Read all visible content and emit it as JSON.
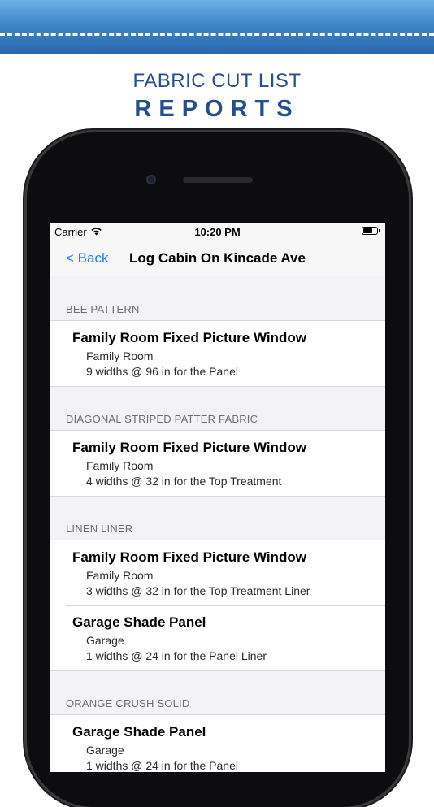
{
  "promo": {
    "line1": "FABRIC CUT LIST",
    "line2": "REPORTS"
  },
  "status_bar": {
    "carrier": "Carrier",
    "time": "10:20 PM"
  },
  "nav": {
    "back_label": "< Back",
    "title": "Log Cabin On Kincade Ave"
  },
  "sections": [
    {
      "header": "BEE PATTERN",
      "rows": [
        {
          "title": "Family Room Fixed Picture Window",
          "room": "Family Room",
          "detail": "9 widths @ 96 in for the Panel"
        }
      ]
    },
    {
      "header": "DIAGONAL STRIPED PATTER FABRIC",
      "rows": [
        {
          "title": "Family Room Fixed Picture Window",
          "room": "Family Room",
          "detail": "4 widths @ 32 in for the Top Treatment"
        }
      ]
    },
    {
      "header": "LINEN LINER",
      "rows": [
        {
          "title": "Family Room Fixed Picture Window",
          "room": "Family Room",
          "detail": "3 widths @ 32 in for the Top Treatment Liner"
        },
        {
          "title": "Garage Shade Panel",
          "room": "Garage",
          "detail": "1 widths @ 24 in for the Panel Liner"
        }
      ]
    },
    {
      "header": "ORANGE CRUSH SOLID",
      "rows": [
        {
          "title": "Garage Shade Panel",
          "room": "Garage",
          "detail": "1 widths @ 24 in for the Panel"
        }
      ]
    }
  ],
  "colors": {
    "accent": "#2f7cf6",
    "promo_text": "#244f8e",
    "banner": "#3f86c9"
  }
}
